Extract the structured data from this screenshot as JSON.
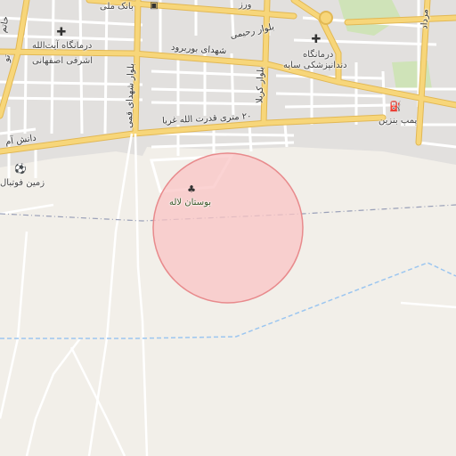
{
  "map": {
    "labels": {
      "bank_meli": "بانک ملی",
      "clinic_ayatollah_line1": "درمانگاه آیت‌الله",
      "clinic_ayatollah_line2": "اشرفی اصفهانی",
      "khatam": "خاتم",
      "shohada_borborud": "شهدای بوربرود",
      "rahimi_blvd": "بلوار رحیمی",
      "shohada_qomi_blvd": "بلوار شهدای قمی",
      "clinic_saye_line1": "درمانگاه",
      "clinic_saye_line2": "دندانپزشکی سایه",
      "moradi": "مرداد",
      "fuel_station": "پمپ بنزین",
      "qodratollah_st": "۲۰ متری قدرت الله غربا",
      "karbala_blvd": "بلوار کربلا",
      "daneshgah_st": "دانش آم",
      "football_field": "زمین فوتبال",
      "park_laleh": "بوستان لاله",
      "road_west_top": "تو",
      "vorud": "ورز"
    },
    "icons": {
      "hospital_1": "plus-icon",
      "hospital_2": "plus-icon",
      "fuel": "fuel-pump-icon",
      "bank": "bank-icon",
      "park": "tree-icon",
      "football": "football-icon"
    },
    "colors": {
      "background": "#f2efe9",
      "major_road": "#f7d67a",
      "major_road_casing": "#e0b84a",
      "minor_road": "#ffffff",
      "urban_area": "#e0dfdf",
      "park": "#c8dfae",
      "accuracy_circle_fill": "#f9c0c0",
      "accuracy_circle_stroke": "#e8888a",
      "boundary": "#9aa0b8",
      "waterway": "#9cc6f0"
    }
  }
}
